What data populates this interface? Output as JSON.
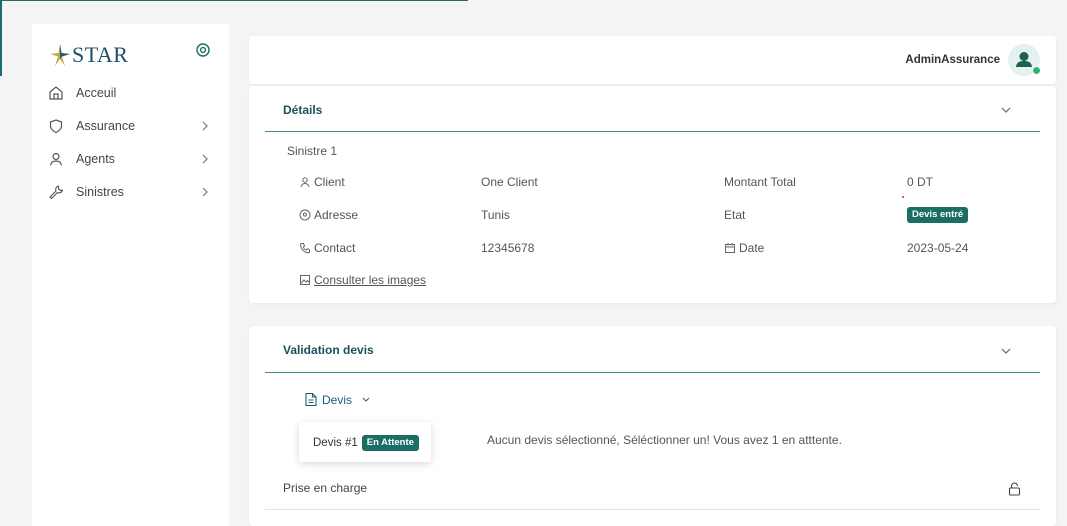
{
  "sidebar": {
    "logo_text": "STAR",
    "items": [
      {
        "label": "Acceuil",
        "icon": "home-icon",
        "has_chevron": false
      },
      {
        "label": "Assurance",
        "icon": "shield-icon",
        "has_chevron": true
      },
      {
        "label": "Agents",
        "icon": "user-icon",
        "has_chevron": true
      },
      {
        "label": "Sinistres",
        "icon": "wrench-icon",
        "has_chevron": true
      }
    ]
  },
  "header": {
    "user_name": "AdminAssurance"
  },
  "details": {
    "title": "Détails",
    "sinistre_name": "Sinistre 1",
    "client_label": "Client",
    "client_value": "One Client",
    "address_label": "Adresse",
    "address_value": "Tunis",
    "contact_label": "Contact",
    "contact_value": "12345678",
    "images_link": "Consulter les images",
    "total_label": "Montant Total",
    "total_value": "0 DT",
    "state_label": "Etat",
    "state_value": "Devis entré",
    "date_label": "Date",
    "date_value": "2023-05-24"
  },
  "validation": {
    "title": "Validation devis",
    "devis_button": "Devis",
    "dropdown_item_label": "Devis #1",
    "dropdown_item_badge": "En Attente",
    "message": "Aucun devis sélectionné, Séléctionner un! Vous avez 1 en atttente.",
    "prise_label": "Prise en charge"
  },
  "colors": {
    "accent": "#1b6e63",
    "divider": "#3c8c86",
    "heading": "#1e4e60",
    "online": "#2bb673"
  }
}
